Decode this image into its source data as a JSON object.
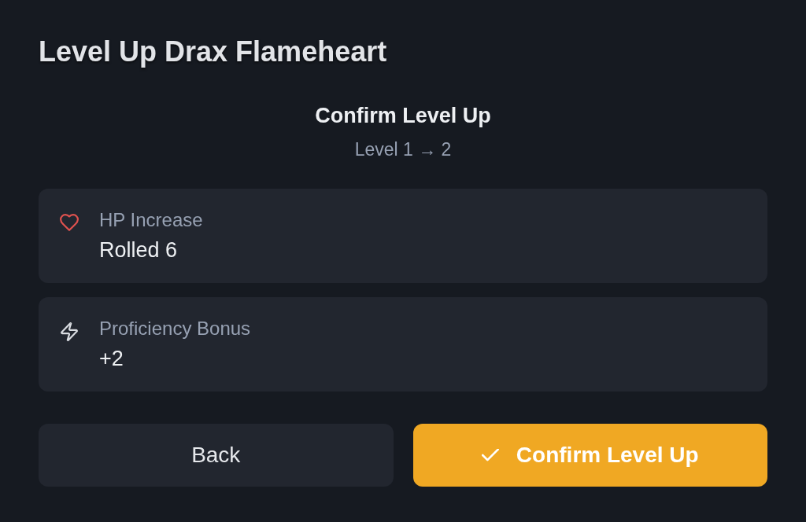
{
  "dialog": {
    "title": "Level Up Drax Flameheart"
  },
  "summary": {
    "heading": "Confirm Level Up",
    "subheading": "Level 1 → 2"
  },
  "changes": [
    {
      "kind": "heart",
      "label": "HP Increase",
      "value": "Rolled 6"
    },
    {
      "kind": "bolt",
      "label": "Proficiency Bonus",
      "value": "+2"
    }
  ],
  "buttons": [
    {
      "kind": "secondary",
      "label": "Back"
    },
    {
      "kind": "primary",
      "label": "Confirm Level Up"
    }
  ]
}
